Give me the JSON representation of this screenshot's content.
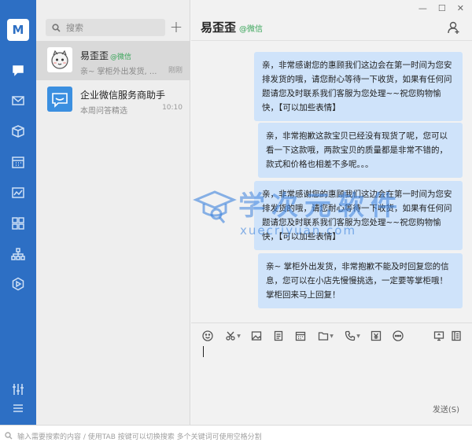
{
  "sidebar": {
    "logo_text": "M",
    "icons": [
      "chat-icon",
      "mail-icon",
      "cube-icon",
      "calendar-icon",
      "chart-icon",
      "apps-icon",
      "org-icon",
      "hexagon-icon",
      "settings-sliders-icon",
      "menu-icon"
    ]
  },
  "search": {
    "placeholder": "搜索"
  },
  "conversations": [
    {
      "name": "易歪歪",
      "tag": "@微信",
      "preview": "亲~ 掌柜外出发货, ...",
      "time": "刚刚"
    },
    {
      "name": "企业微信服务商助手",
      "tag": "",
      "preview": "本周问答精选",
      "time": "10:10"
    }
  ],
  "chat": {
    "title": "易歪歪",
    "source": "@微信",
    "messages": [
      "亲，非常感谢您的惠顾我们这边会在第一时间为您安排发货的哦，请您耐心等待一下收货，如果有任何问题请您及时联系我们客服为您处理~~祝您购物愉快，【可以加些表情】",
      "亲，非常抱歉这款宝贝已经没有现货了呢，您可以看一下这款哦，两款宝贝的质量都是非常不错的，款式和价格也相差不多呢。。。",
      "亲，非常感谢您的惠顾我们这边会在第一时间为您安排发货的哦，请您耐心等待一下收货，如果有任何问题请您及时联系我们客服为您处理~~祝您购物愉快，【可以加些表情】",
      "亲~ 掌柜外出发货，非常抱歉不能及时回复您的信息，您可以在小店先慢慢挑选，一定要等掌柜哦！掌柜回来马上回复！"
    ],
    "send_label": "发送(S)"
  },
  "watermark": {
    "text": "学次元软件",
    "url": "xuecriyuan.com"
  },
  "statusbar": {
    "hint": "输入需要搜索的内容 / 使用TAB 按键可以切换搜索 多个关键词可使用空格分割"
  },
  "colors": {
    "rail": "#2d6fc4",
    "bubble": "#cfe3fa",
    "tag_green": "#3aa55a"
  }
}
